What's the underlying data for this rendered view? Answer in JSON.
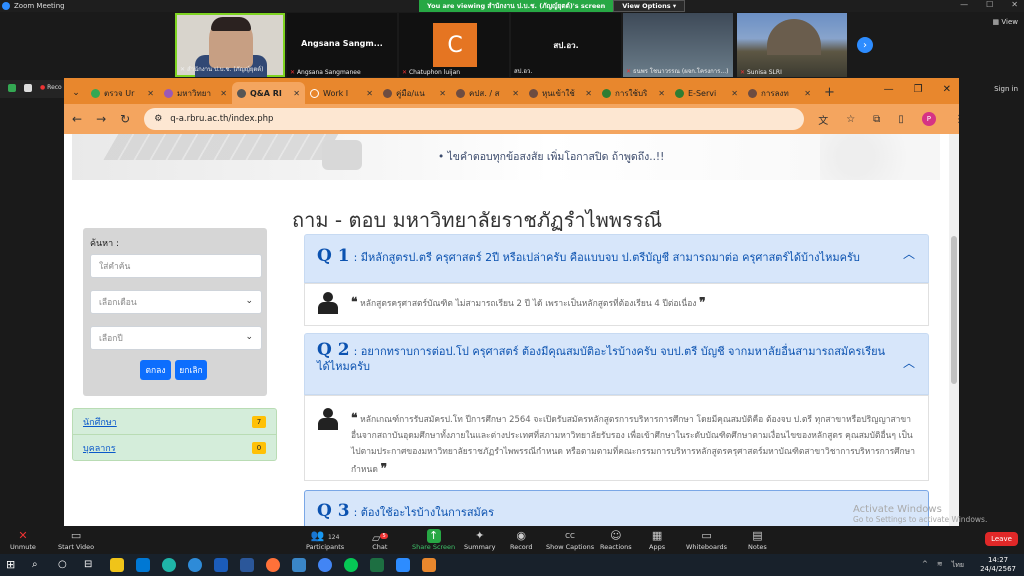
{
  "zoom": {
    "window_title": "Zoom Meeting",
    "banner_text": "You are viewing สำนักงาน ป.บ.ช. (ภัญญ์ยุตต์)'s screen",
    "view_options": "View Options",
    "view_btn": "View",
    "recording": "Reco",
    "sign_in": "Sign in",
    "participants": [
      {
        "name": "สำนักงาน ป.บ.ช. (ภัญญ์ยุตต์)",
        "center": ""
      },
      {
        "name": "",
        "center": "Angsana  Sangm..."
      },
      {
        "name": "Angsana Sangmanee",
        "center": ""
      },
      {
        "name": "Chatuphon luijan",
        "avatar": "C"
      },
      {
        "name": "สป.อว.",
        "center": "สป.อว."
      },
      {
        "name": "ธนพร โชนาวรรณ (ผจก.โครงการ...)",
        "center": ""
      },
      {
        "name": "Sunisa SLRI",
        "center": ""
      }
    ],
    "toolbar": [
      {
        "label": "Unmute",
        "icon": "mic-muted-icon",
        "glyph": "🎤"
      },
      {
        "label": "Start Video",
        "icon": "video-off-icon",
        "glyph": "🎥"
      },
      {
        "label": "Participants",
        "icon": "participants-icon",
        "glyph": "👥",
        "count": "124"
      },
      {
        "label": "Chat",
        "icon": "chat-icon",
        "glyph": "💬",
        "badge": "5"
      },
      {
        "label": "Share Screen",
        "icon": "share-screen-icon",
        "glyph": "⬆"
      },
      {
        "label": "Summary",
        "icon": "summary-icon",
        "glyph": "▤"
      },
      {
        "label": "Record",
        "icon": "record-icon",
        "glyph": "◉"
      },
      {
        "label": "Show Captions",
        "icon": "captions-icon",
        "glyph": "CC"
      },
      {
        "label": "Reactions",
        "icon": "reactions-icon",
        "glyph": "☺"
      },
      {
        "label": "Apps",
        "icon": "apps-icon",
        "glyph": "▦"
      },
      {
        "label": "Whiteboards",
        "icon": "whiteboard-icon",
        "glyph": "▭"
      },
      {
        "label": "Notes",
        "icon": "notes-icon",
        "glyph": "▤"
      }
    ],
    "leave": "Leave"
  },
  "browser": {
    "tabs": [
      {
        "title": "",
        "color": "#34a853"
      },
      {
        "title": "ตรวจ Ur",
        "color": "#34a853"
      },
      {
        "title": "มหาวิทยา",
        "color": "#9b59b6"
      },
      {
        "title": "Q&A RI",
        "color": "#555555",
        "active": true
      },
      {
        "title": "Work I",
        "color": "#e8872d"
      },
      {
        "title": "คู่มือ/แน",
        "color": "#6d4c41"
      },
      {
        "title": "คปส. / ส",
        "color": "#6d4c41"
      },
      {
        "title": "หุนเข้าใช้",
        "color": "#6d4c41"
      },
      {
        "title": "การใช้บริ",
        "color": "#2e7d32"
      },
      {
        "title": "E-Servi",
        "color": "#2e7d32"
      },
      {
        "title": "การลงท",
        "color": "#6d4c41"
      }
    ],
    "new_tab": "+",
    "url": "q-a.rbru.ac.th/index.php",
    "profile": "P"
  },
  "page": {
    "banner_text": "• ไขคำตอบทุกข้อสงสัย เพิ่มโอกาสปิด ถ้าพูดถึง..!!",
    "title": "ถาม - ตอบ มหาวิทยาลัยราชภัฏรำไพพรรณี",
    "search": {
      "label": "ค้นหา :",
      "keyword_placeholder": "ใส่คำค้น",
      "month_placeholder": "เลือกเดือน",
      "year_placeholder": "เลือกปี",
      "submit": "ตกลง",
      "cancel": "ยกเลิก"
    },
    "categories": [
      {
        "label": "นักศึกษา",
        "count": "7"
      },
      {
        "label": "บุคลากร",
        "count": "0"
      }
    ],
    "qa": [
      {
        "num": "Q 1",
        "question": ": มีหลักสูตรป.ตรี ครุศาสตร์ 2ปี หรือเปล่าครับ คือแบบจบ ป.ตรีบัญชี สามารถมาต่อ ครุศาสตร์ได้บ้างไหมครับ",
        "answer": "หลักสูตรครุศาสตร์บัณฑิต ไม่สามารถเรียน 2 ปี ได้ เพราะเป็นหลักสูตรที่ต้องเรียน 4 ปีต่อเนื่อง"
      },
      {
        "num": "Q 2",
        "question": ": อยากทราบการต่อป.โป ครุศาสตร์ ต้องมีคุณสมบัติอะไรบ้างครับ จบป.ตรี บัญชี จากมหาลัยอื่นสามารถสมัครเรียนได้ไหมครับ",
        "answer": "หลักเกณฑ์การรับสมัครป.โท ปีการศึกษา 2564 จะเปิดรับสมัครหลักสูตรการบริหารการศึกษา โดยมีคุณสมบัติคือ ต้องจบ ป.ตรี ทุกสาขาหรือปริญญาสาขาอื่นจากสถาบันอุดมศึกษาทั้งภายในและต่างประเทศที่สภามหาวิทยาลัยรับรอง เพื่อเข้าศึกษาในระดับบัณฑิตศึกษาตามเงื่อนไขของหลักสูตร คุณสมบัติอื่นๆ เป็นไปตามประกาศของมหาวิทยาลัยราชภัฏรำไพพรรณีกำหนด หรือตามตามที่คณะกรรมการบริหารหลักสูตรครุศาสตร์มหาบัณฑิตสาขาวิชาการบริหารการศึกษากำหนด"
      },
      {
        "num": "Q 3",
        "question": ": ต้องใช้อะไรบ้างในการสมัคร",
        "answer": ""
      }
    ]
  },
  "windows": {
    "activate_title": "Activate Windows",
    "activate_sub": "Go to Settings to activate Windows.",
    "tray": "ไทย",
    "time": "14:27",
    "date": "24/4/2567"
  }
}
